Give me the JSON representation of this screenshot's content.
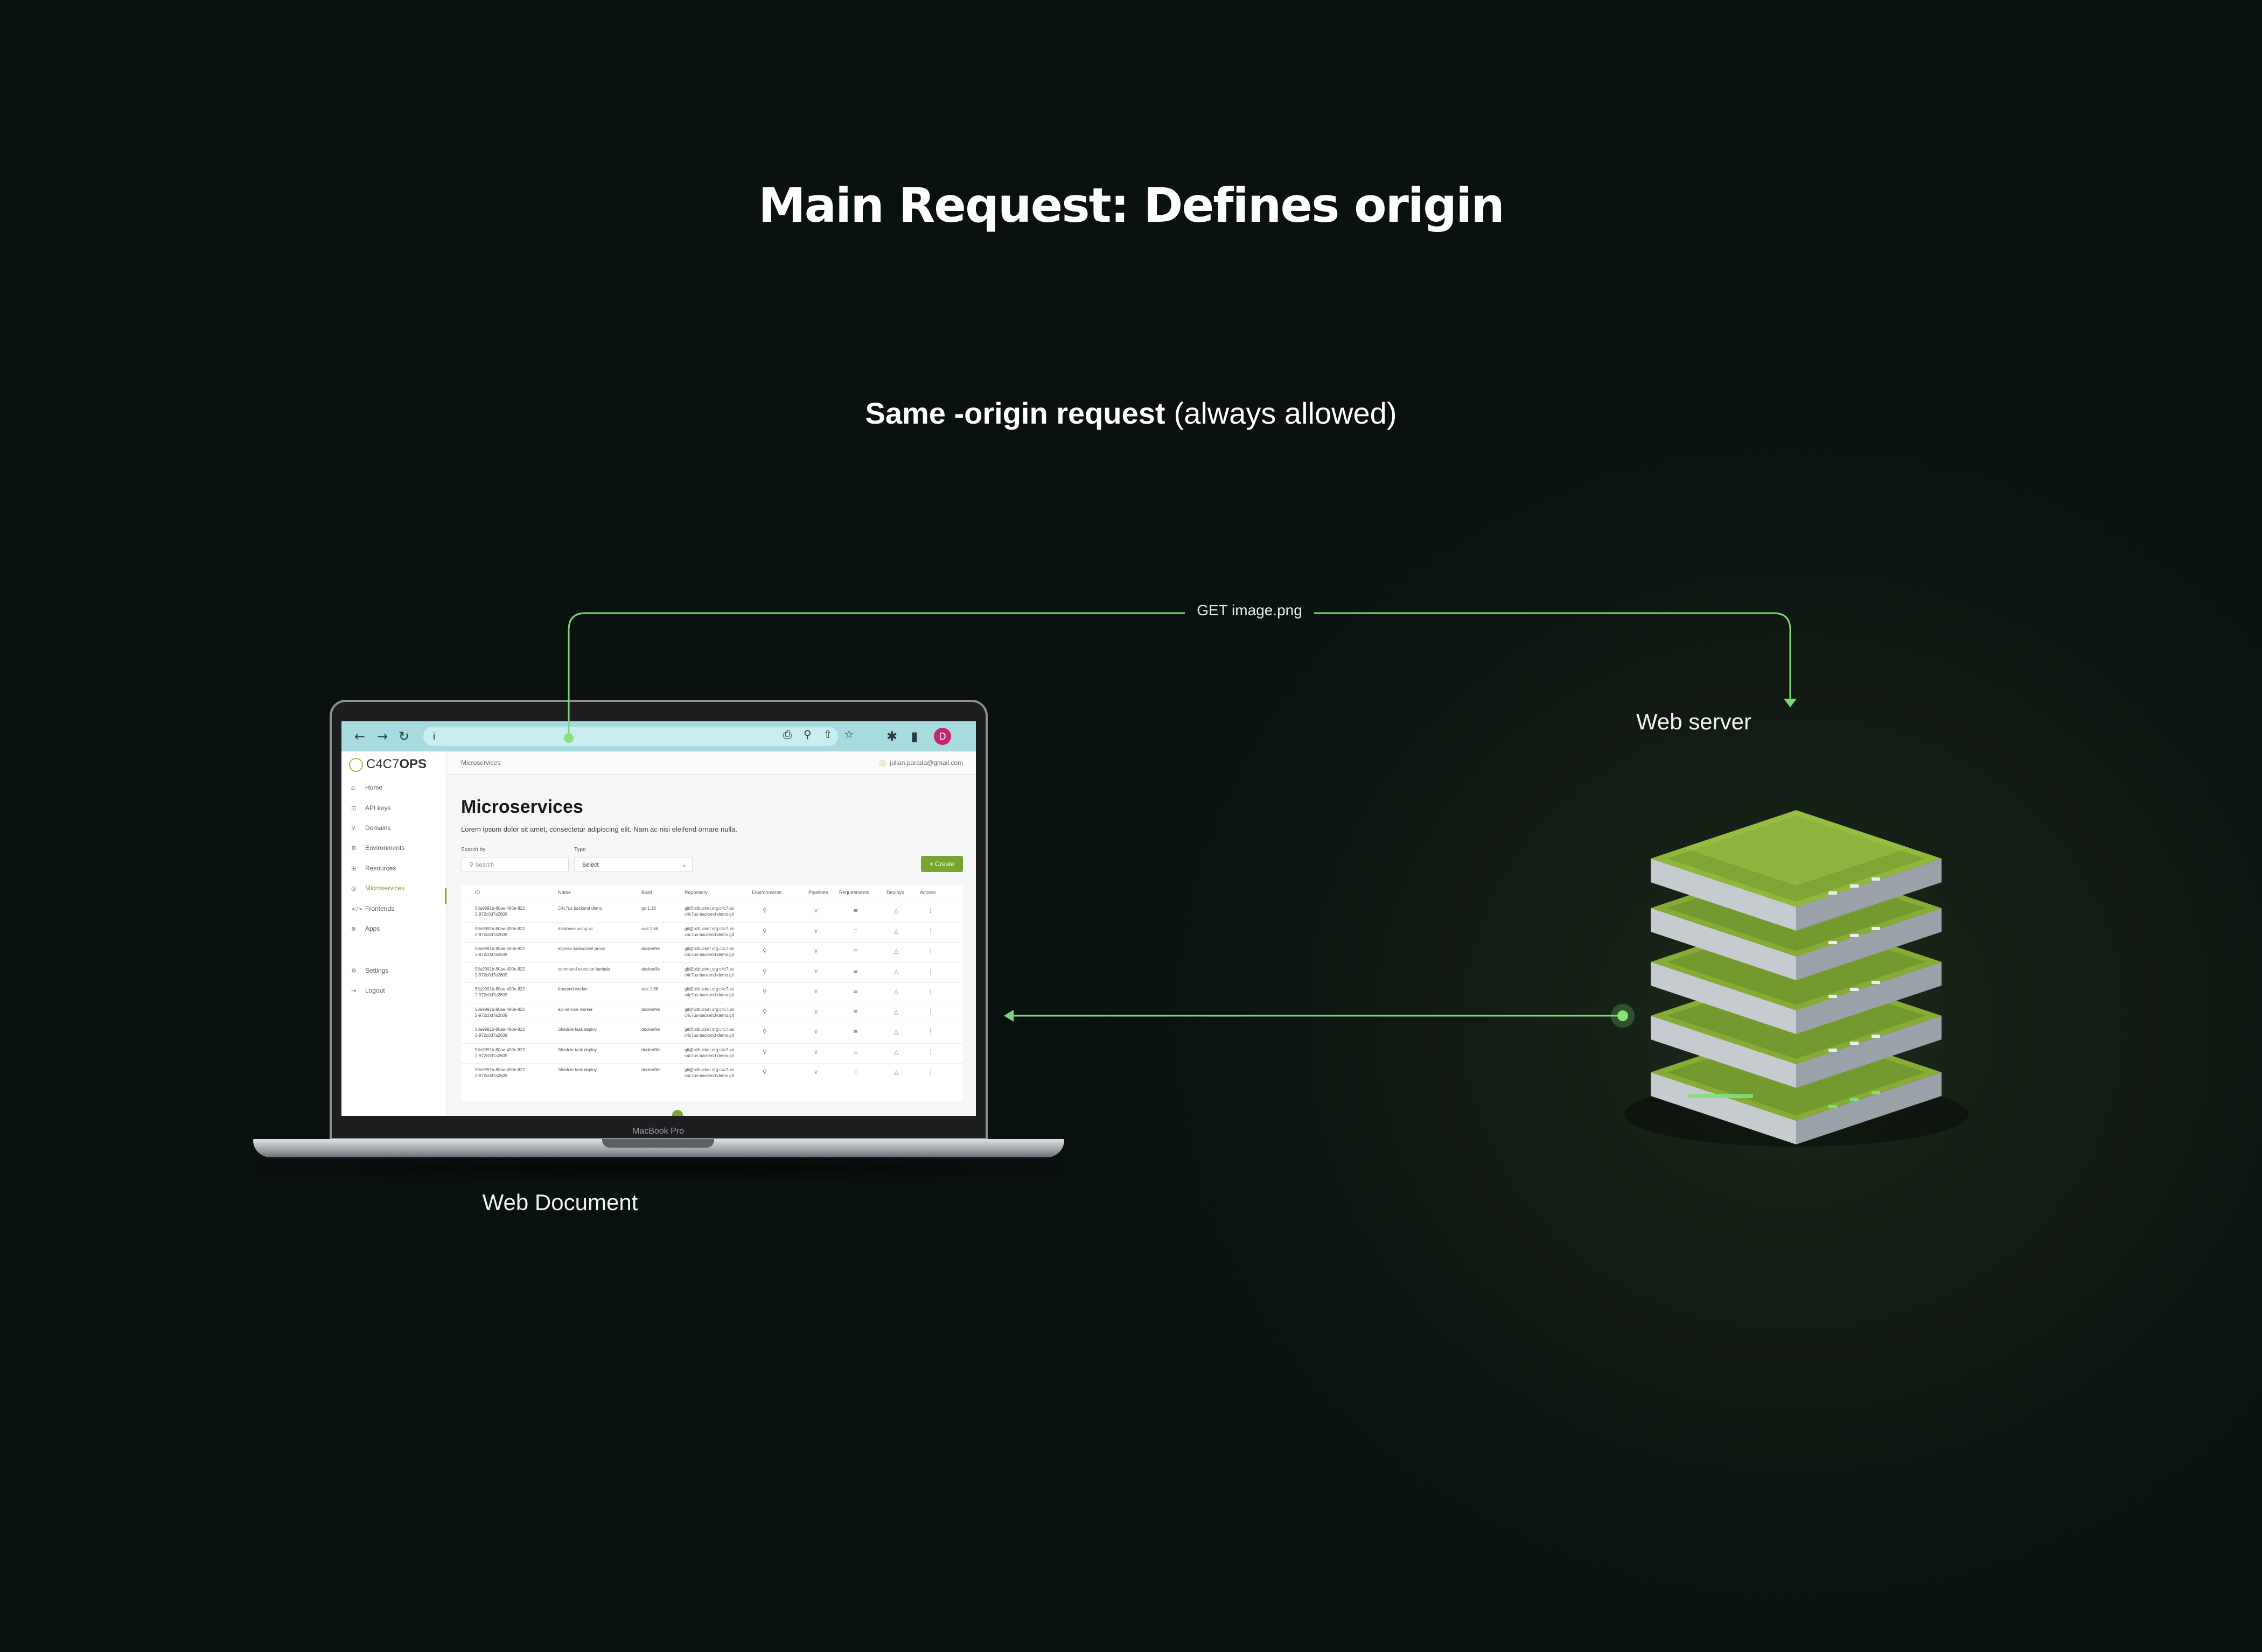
{
  "title": "Main Request: Defines origin",
  "subtitle": {
    "bold": "Same -origin request",
    "paren": "(always allowed)"
  },
  "request_label": "GET image.png",
  "nodes": {
    "client": "Web Document",
    "server": "Web server"
  },
  "laptop": {
    "brand": "MacBook Pro",
    "browser": {
      "url": "i",
      "avatar_letter": "D"
    },
    "app": {
      "logo_light": "C4C7",
      "logo_bold": "OPS",
      "breadcrumb": "Microservices",
      "user_email": "julian.parada@gmail.com",
      "page_title": "Microservices",
      "page_description": "Lorem ipsum dolor sit amet, consectetur adipiscing elit. Nam ac nisi eleifend ornare nulla.",
      "search_label": "Search by",
      "search_placeholder": "Search",
      "type_label": "Type",
      "type_value": "Select",
      "create_label": "+ Create",
      "sidebar": [
        {
          "icon": "⌂",
          "label": "Home"
        },
        {
          "icon": "⊡",
          "label": "API keys"
        },
        {
          "icon": "⚲",
          "label": "Domains"
        },
        {
          "icon": "⚙",
          "label": "Environments"
        },
        {
          "icon": "⊞",
          "label": "Resources"
        },
        {
          "icon": "◎",
          "label": "Microservices"
        },
        {
          "icon": "</>",
          "label": "Frontends"
        },
        {
          "icon": "⊕",
          "label": "Apps"
        },
        {
          "icon": "⚙",
          "label": "Settings"
        },
        {
          "icon": "⇥",
          "label": "Logout"
        }
      ],
      "active_item": "Microservices",
      "columns": [
        "ID",
        "Name",
        "Build",
        "Repository",
        "Environments",
        "Pipelines",
        "Requirements",
        "Deploys",
        "Actions"
      ],
      "rows": [
        {
          "id1": "58a9991b-80ae-490e-822",
          "id2": "2-972c0d7a2609",
          "name": "C4c7us backend demo",
          "build": "go 1.18",
          "repo1": "git@bitbucket.org:c4c7us/",
          "repo2": "c4c7us-backend-demo.git"
        },
        {
          "id1": "58a9991b-80ae-490e-822",
          "id2": "2-972c0d7a2609",
          "name": "database using wl",
          "build": "rust 1.66",
          "repo1": "git@bitbucket.org:c4c7us/",
          "repo2": "c4c7us-backend-demo.git"
        },
        {
          "id1": "58a9991b-80ae-490e-822",
          "id2": "2-972c0d7a2609",
          "name": "ingress websocket proxy",
          "build": "dockerfile",
          "repo1": "git@bitbucket.org:c4c7us/",
          "repo2": "c4c7us-backend-demo.git"
        },
        {
          "id1": "58a9991b-80ae-490e-822",
          "id2": "2-972c0d7a2609",
          "name": "command executor lambda",
          "build": "dockerfile",
          "repo1": "git@bitbucket.org:c4c7us/",
          "repo2": "c4c7us-backend-demo.git"
        },
        {
          "id1": "58a9991b-80ae-490e-822",
          "id2": "2-972c0d7a2609",
          "name": "frontend worker",
          "build": "rust 1.66",
          "repo1": "git@bitbucket.org:c4c7us/",
          "repo2": "c4c7us-backend-demo.git"
        },
        {
          "id1": "58a9991b-80ae-490e-822",
          "id2": "2-972c0d7a2609",
          "name": "api service worker",
          "build": "dockerfile",
          "repo1": "git@bitbucket.org:c4c7us/",
          "repo2": "c4c7us-backend-demo.git"
        },
        {
          "id1": "58a9991b-80ae-490e-822",
          "id2": "2-972c0d7a2609",
          "name": "Shedule task deploy",
          "build": "dockerfile",
          "repo1": "git@bitbucket.org:c4c7us/",
          "repo2": "c4c7us-backend-demo.git"
        },
        {
          "id1": "58a9991b-80ae-490e-822",
          "id2": "2-972c0d7a2609",
          "name": "Shedule task deploy",
          "build": "dockerfile",
          "repo1": "git@bitbucket.org:c4c7us/",
          "repo2": "c4c7us-backend-demo.git"
        },
        {
          "id1": "58a9991b-80ae-490e-822",
          "id2": "2-972c0d7a2609",
          "name": "Shedule task deploy",
          "build": "dockerfile",
          "repo1": "git@bitbucket.org:c4c7us/",
          "repo2": "c4c7us-backend-demo.git"
        }
      ]
    }
  },
  "colors": {
    "background": "#0d1511",
    "accent_green": "#7fd67a",
    "server_green": "#8fb83a",
    "app_accent": "#7aa52e"
  }
}
